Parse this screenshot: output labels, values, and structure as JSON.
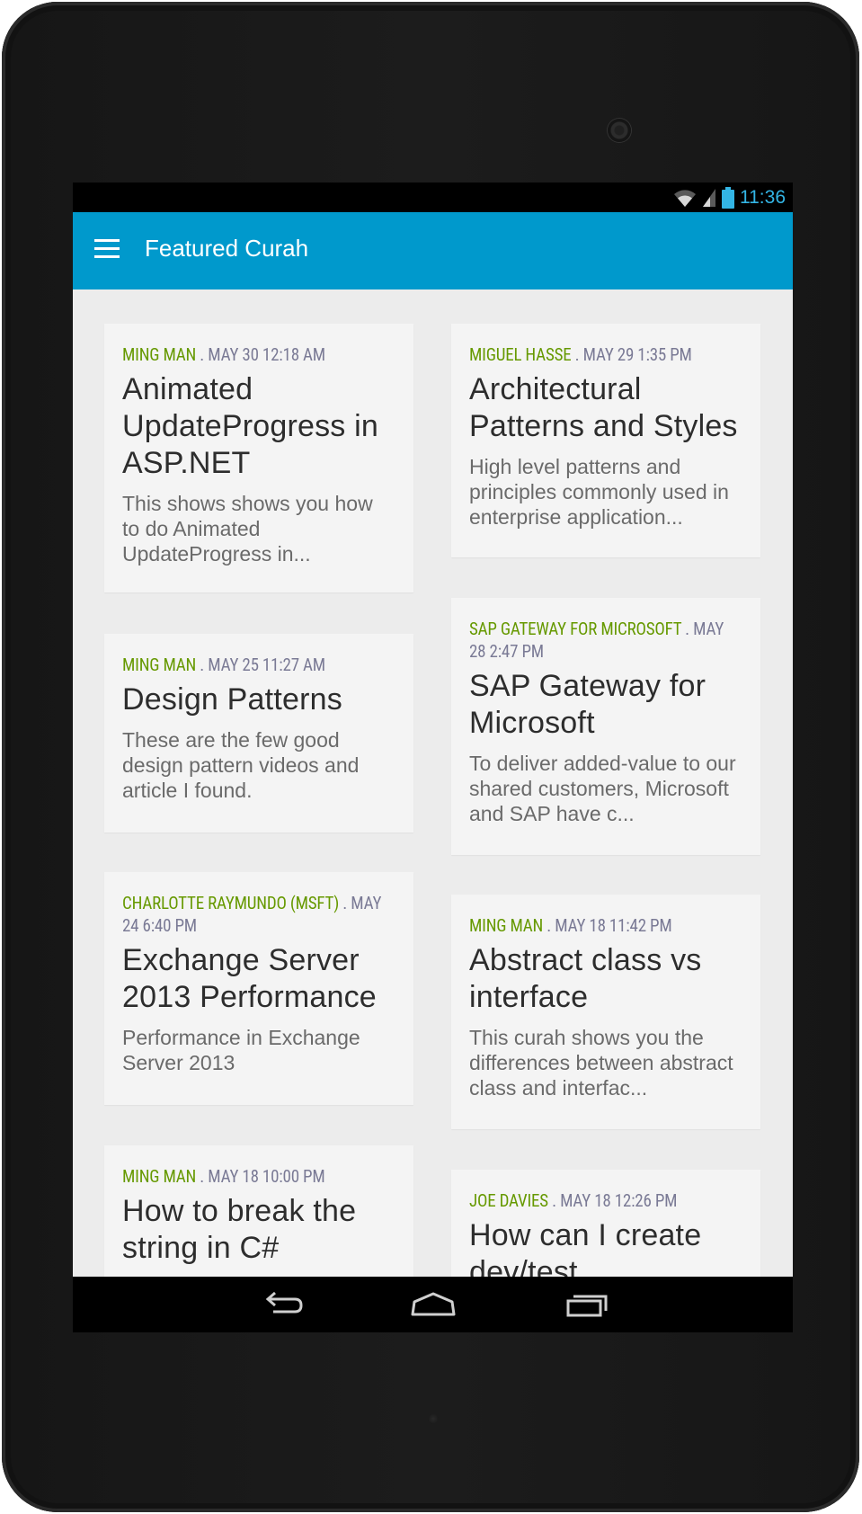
{
  "status_bar": {
    "time": "11:36"
  },
  "app_bar": {
    "title": "Featured Curah"
  },
  "cards": [
    {
      "author": "MING MAN",
      "sep": " . ",
      "date": "MAY 30 12:18 AM",
      "title": "Animated UpdateProgress in ASP.NET",
      "description": "This shows shows you how to do Animated UpdateProgress in..."
    },
    {
      "author": "MIGUEL HASSE",
      "sep": " . ",
      "date": "MAY 29 1:35 PM",
      "title": "Architectural Patterns and Styles",
      "description": "High level patterns and principles commonly used in enterprise application..."
    },
    {
      "author": "MING MAN",
      "sep": " . ",
      "date": "MAY 25 11:27 AM",
      "title": "Design Patterns",
      "description": "These are the few good design pattern videos and article I found."
    },
    {
      "author": "SAP GATEWAY FOR MICROSOFT",
      "sep": " . ",
      "date": "MAY 28 2:47 PM",
      "title": "SAP Gateway for Microsoft",
      "description": "To deliver added-value to our shared customers, Microsoft and SAP have c..."
    },
    {
      "author": "CHARLOTTE RAYMUNDO (MSFT)",
      "sep": " . ",
      "date": "MAY 24 6:40 PM",
      "title": "Exchange Server 2013 Performance",
      "description": "Performance in Exchange Server 2013"
    },
    {
      "author": "MING MAN",
      "sep": " . ",
      "date": "MAY 18 11:42 PM",
      "title": "Abstract class vs interface",
      "description": "This curah shows you the differences between abstract class and interfac..."
    },
    {
      "author": "MING MAN",
      "sep": " . ",
      "date": "MAY 18 10:00 PM",
      "title": "How to break the string in C#",
      "description": ""
    },
    {
      "author": "JOE DAVIES",
      "sep": " . ",
      "date": "MAY 18 12:26 PM",
      "title": "How can I create dev/test",
      "description": ""
    }
  ],
  "nav": {
    "icons": [
      "back-icon",
      "home-icon",
      "recents-icon"
    ]
  },
  "colors": {
    "appbar": "#0099cc",
    "author": "#669900",
    "date": "#7a7a95",
    "status_time": "#33b5e5"
  }
}
